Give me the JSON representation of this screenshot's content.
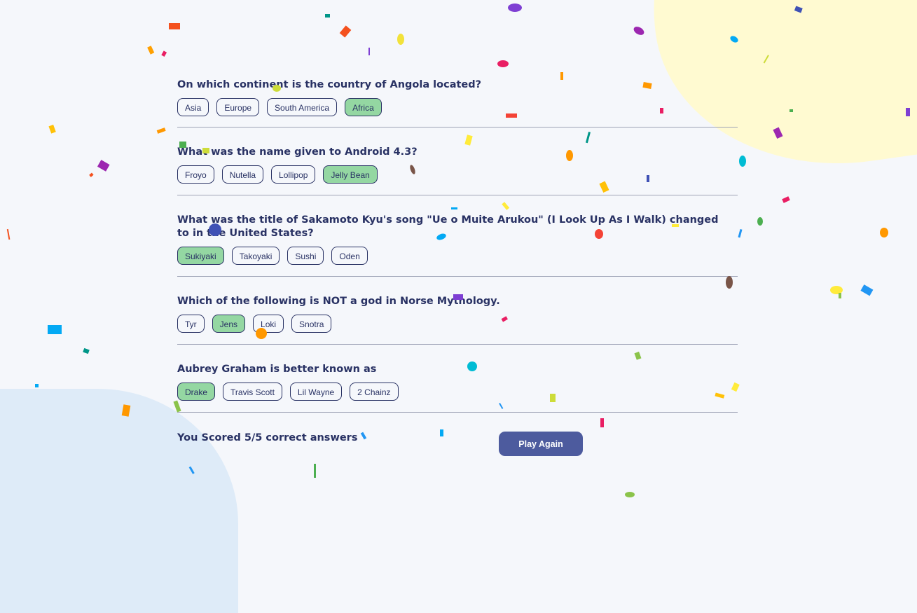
{
  "questions": [
    {
      "text": "On which continent is the country of Angola located?",
      "answers": [
        {
          "label": "Asia",
          "selected": false
        },
        {
          "label": "Europe",
          "selected": false
        },
        {
          "label": "South America",
          "selected": false
        },
        {
          "label": "Africa",
          "selected": true
        }
      ]
    },
    {
      "text": "What was the name given to Android 4.3?",
      "answers": [
        {
          "label": "Froyo",
          "selected": false
        },
        {
          "label": "Nutella",
          "selected": false
        },
        {
          "label": "Lollipop",
          "selected": false
        },
        {
          "label": "Jelly Bean",
          "selected": true
        }
      ]
    },
    {
      "text": "What was the title of Sakamoto Kyu's song \"Ue o Muite Arukou\" (I Look Up As I Walk) changed to in the United States?",
      "answers": [
        {
          "label": "Sukiyaki",
          "selected": true
        },
        {
          "label": "Takoyaki",
          "selected": false
        },
        {
          "label": "Sushi",
          "selected": false
        },
        {
          "label": "Oden",
          "selected": false
        }
      ]
    },
    {
      "text": "Which of the following is NOT a god in Norse Mythology.",
      "answers": [
        {
          "label": "Tyr",
          "selected": false
        },
        {
          "label": "Jens",
          "selected": true
        },
        {
          "label": "Loki",
          "selected": false
        },
        {
          "label": "Snotra",
          "selected": false
        }
      ]
    },
    {
      "text": "Aubrey Graham is better known as",
      "answers": [
        {
          "label": "Drake",
          "selected": true
        },
        {
          "label": "Travis Scott",
          "selected": false
        },
        {
          "label": "Lil Wayne",
          "selected": false
        },
        {
          "label": "2 Chainz",
          "selected": false
        }
      ]
    }
  ],
  "footer": {
    "score_text": "You Scored 5/5 correct answers",
    "play_again_label": "Play Again"
  },
  "colors": {
    "text": "#293264",
    "selected_answer": "#94d7a2",
    "button": "#4d5b9e",
    "background": "#f5f7fb"
  }
}
